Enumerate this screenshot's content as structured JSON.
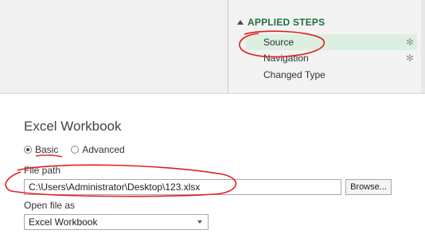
{
  "applied_steps": {
    "header": "APPLIED STEPS",
    "items": [
      {
        "label": "Source",
        "selected": true,
        "has_gear": true
      },
      {
        "label": "Navigation",
        "selected": false,
        "has_gear": true
      },
      {
        "label": "Changed Type",
        "selected": false,
        "has_gear": false
      }
    ],
    "gear_icon": "gear-icon"
  },
  "dialog": {
    "title": "Excel Workbook",
    "mode": {
      "options": [
        "Basic",
        "Advanced"
      ],
      "selected": "Basic"
    },
    "file_path": {
      "label": "File path",
      "value": "C:\\Users\\Administrator\\Desktop\\123.xlsx"
    },
    "browse_label": "Browse...",
    "open_as": {
      "label": "Open file as",
      "value": "Excel Workbook"
    }
  },
  "colors": {
    "steps_header": "#1e6f3f",
    "selected_step_bg": "#dcefe1",
    "annotation_red": "#e02020"
  }
}
